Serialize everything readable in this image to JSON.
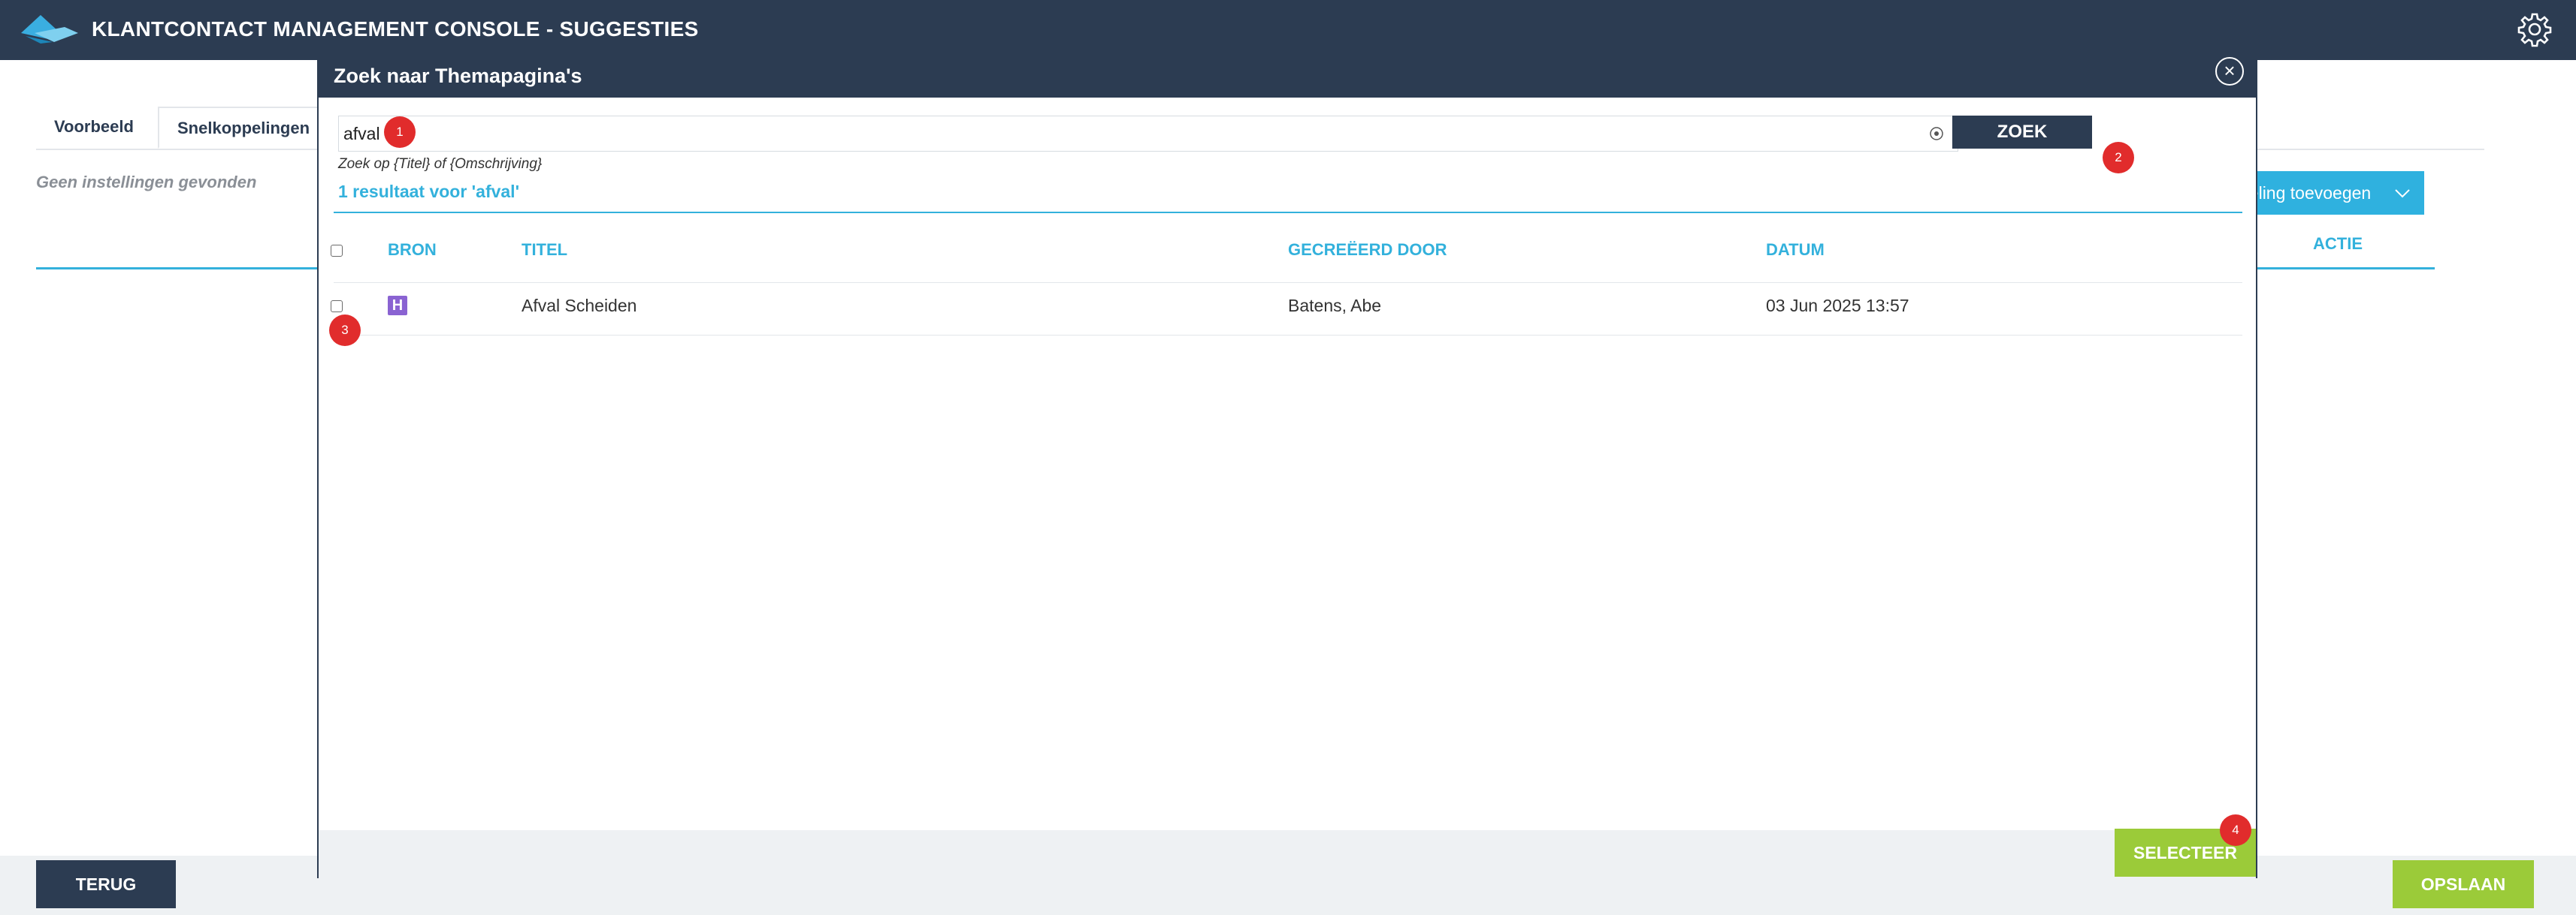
{
  "app": {
    "title": "KLANTCONTACT MANAGEMENT CONSOLE - SUGGESTIES",
    "logo_icon": "brand-logo-icon",
    "settings_icon": "gear-icon"
  },
  "background_page": {
    "tabs": [
      {
        "label": "Voorbeeld"
      },
      {
        "label": "Snelkoppelingen"
      }
    ],
    "empty_message": "Geen instellingen gevonden",
    "add_button_label": "peling toevoegen",
    "column_actie": "ACTIE",
    "footer": {
      "back_label": "TERUG",
      "save_label": "OPSLAAN"
    }
  },
  "modal": {
    "title": "Zoek naar Themapagina's",
    "search": {
      "value": "afval",
      "hint": "Zoek op {Titel} of {Omschrijving}",
      "button_label": "ZOEK"
    },
    "result_summary": "1 resultaat voor 'afval'",
    "table": {
      "headers": {
        "bron": "BRON",
        "titel": "TITEL",
        "gecreeerd_door": "GECREËERD DOOR",
        "datum": "DATUM"
      },
      "rows": [
        {
          "bron_badge": "H",
          "titel": "Afval Scheiden",
          "gecreeerd_door": "Batens, Abe",
          "datum": "03 Jun 2025 13:57",
          "checked": false
        }
      ]
    },
    "select_button_label": "SELECTEER"
  },
  "markers": [
    "1",
    "2",
    "3",
    "4"
  ],
  "colors": {
    "header_bg": "#2c3c52",
    "accent_blue": "#33b1dc",
    "primary_green": "#9bcb39",
    "marker_red": "#e12c2c",
    "badge_purple": "#8a63d2"
  }
}
